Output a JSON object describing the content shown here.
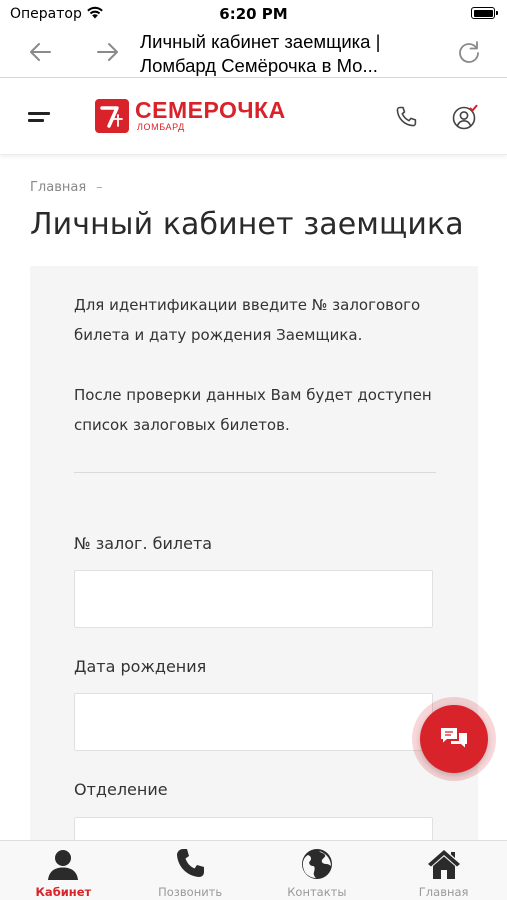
{
  "status_bar": {
    "carrier": "Оператор",
    "time": "6:20 PM"
  },
  "browser": {
    "title_line1": "Личный кабинет заемщика |",
    "title_line2": "Ломбард Семёрочка в Мо..."
  },
  "header": {
    "logo_main": "СЕМЕРОЧКА",
    "logo_sub": "ЛОМБАРД"
  },
  "breadcrumb": {
    "home": "Главная",
    "separator": "–"
  },
  "page": {
    "heading": "Личный кабинет заемщика"
  },
  "form": {
    "info_1": "Для идентификации введите № залогового билета и дату рождения Заемщика.",
    "info_2": "После проверки данных Вам будет доступен список залоговых билетов.",
    "ticket_label": "№ залог. билета",
    "ticket_value": "",
    "dob_label": "Дата рождения",
    "dob_value": "",
    "branch_label": "Отделение"
  },
  "tabs": [
    {
      "label": "Кабинет",
      "icon": "user-icon",
      "active": true
    },
    {
      "label": "Позвонить",
      "icon": "phone-icon",
      "active": false
    },
    {
      "label": "Контакты",
      "icon": "globe-icon",
      "active": false
    },
    {
      "label": "Главная",
      "icon": "home-icon",
      "active": false
    }
  ],
  "colors": {
    "brand_red": "#d8232a",
    "card_bg": "#f5f5f5",
    "inactive_tab": "#999999"
  }
}
